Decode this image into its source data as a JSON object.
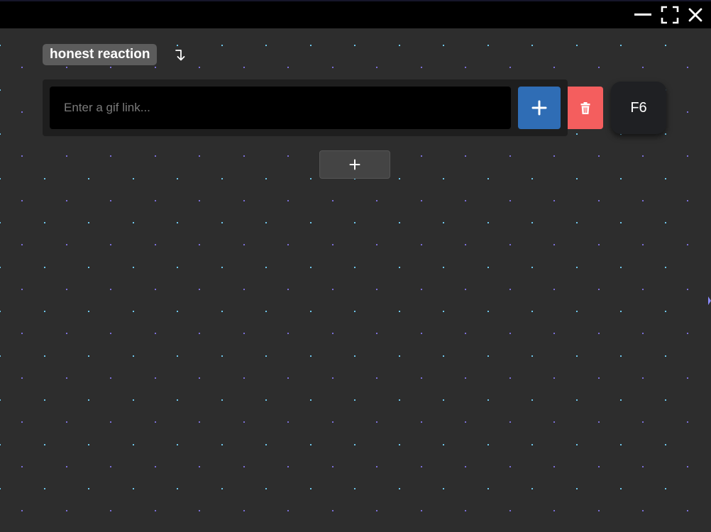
{
  "group": {
    "label": "honest reaction"
  },
  "entry": {
    "placeholder": "Enter a gif link...",
    "value": "",
    "hotkey": "F6"
  },
  "icons": {
    "minimize": "minimize-icon",
    "maximize": "fullscreen-icon",
    "close": "close-icon",
    "collapse": "curved-arrow-down-icon",
    "add": "plus-icon",
    "delete": "trash-icon",
    "add_row": "plus-icon"
  },
  "colors": {
    "background": "#2d2d2d",
    "titlebar": "#000000",
    "label_bg": "#5c5c5c",
    "add_button": "#2f6db5",
    "delete_button": "#f45e5e",
    "hotkey_button": "#1f2023",
    "dot_cyan": "#6ec6ea",
    "dot_purple": "#7b6fd6"
  }
}
